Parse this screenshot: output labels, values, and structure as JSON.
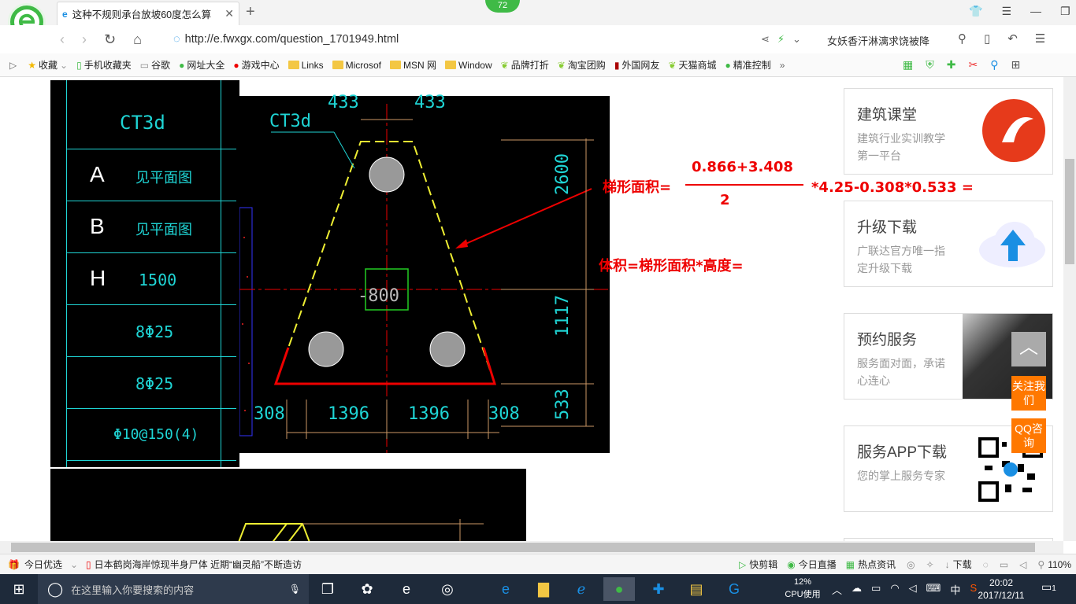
{
  "browser": {
    "tab_title": "这种不规则承台放坡60度怎么算",
    "badge": "72",
    "url": "http://e.fwxgx.com/question_1701949.html",
    "news_ticker": "女妖香汗淋漓求饶被降"
  },
  "favorites": [
    "收藏",
    "手机收藏夹",
    "谷歌",
    "网址大全",
    "游戏中心",
    "Links",
    "Microsof",
    "MSN 网",
    "Window",
    "品牌打折",
    "淘宝团购",
    "外国网友",
    "天猫商城",
    "精准控制"
  ],
  "cad_table": {
    "title": "CT3d",
    "rows": [
      {
        "key": "A",
        "val": "见平面图"
      },
      {
        "key": "B",
        "val": "见平面图"
      },
      {
        "key": "H",
        "val": "1500"
      },
      {
        "key": "",
        "val": "8Φ25"
      },
      {
        "key": "",
        "val": "8Φ25"
      },
      {
        "key": "",
        "val": "Φ10@150(4)"
      }
    ]
  },
  "cad_plan": {
    "label": "CT3d",
    "dim_top_left": "433",
    "dim_top_right": "433",
    "dim_right_top": "2600",
    "dim_right_mid": "1117",
    "dim_right_bot": "533",
    "dims_bottom": [
      "308",
      "1396",
      "1396",
      "308"
    ],
    "center_label": "-800"
  },
  "annotation": {
    "area_label": "梯形面积=",
    "numerator": "0.866+3.408",
    "denominator": "2",
    "tail": "*4.25-0.308*0.533 =",
    "volume": "体积=梯形面积*高度="
  },
  "sidebar": [
    {
      "title": "建筑课堂",
      "sub": "建筑行业实训教学第一平台"
    },
    {
      "title": "升级下载",
      "sub": "广联达官方唯一指定升级下载"
    },
    {
      "title": "预约服务",
      "sub": "服务面对面，承诺心连心"
    },
    {
      "title": "服务APP下载",
      "sub": "您的掌上服务专家"
    }
  ],
  "float_buttons": {
    "follow": "关注我们",
    "qq": "QQ咨询"
  },
  "statusbar": {
    "left1": "今日优选",
    "headline": "日本鹤岗海岸惊现半身尸体 近期“幽灵船”不断造访",
    "r1": "快剪辑",
    "r2": "今日直播",
    "r3": "热点资讯",
    "r4": "下载",
    "zoom": "110%"
  },
  "taskbar": {
    "search": "在这里输入你要搜索的内容",
    "cpu_pct": "12%",
    "cpu_label": "CPU使用",
    "ime": "中",
    "time": "20:02",
    "date": "2017/12/11",
    "notif": "1"
  }
}
